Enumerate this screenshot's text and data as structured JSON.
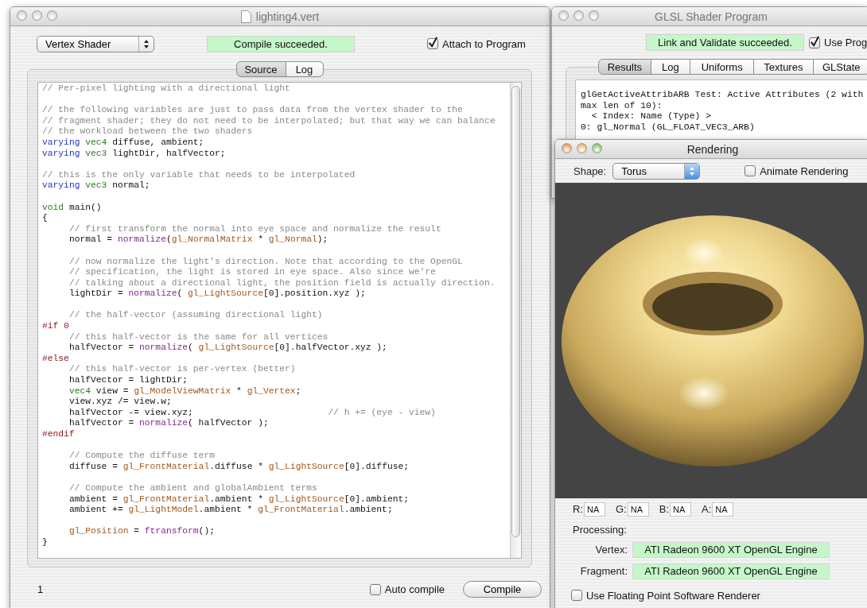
{
  "editor": {
    "title": "lighting4.vert",
    "shader_type": "Vertex Shader",
    "status": "Compile succeeded.",
    "attach": {
      "label": "Attach to Program",
      "checked": true
    },
    "tabs": [
      {
        "label": "Source",
        "selected": true
      },
      {
        "label": "Log",
        "selected": false
      }
    ],
    "code": [
      {
        "kind": "code",
        "tokens": [
          {
            "kind": "comment",
            "text": "// Per-pixel lighting with a directional light"
          }
        ]
      },
      {
        "kind": "blank"
      },
      {
        "kind": "code",
        "tokens": [
          {
            "kind": "comment",
            "text": "// the following variables are just to pass data from the vertex shader to the"
          }
        ]
      },
      {
        "kind": "code",
        "tokens": [
          {
            "kind": "comment",
            "text": "// fragment shader; they do not need to be interpolated; but that way we can balance"
          }
        ]
      },
      {
        "kind": "code",
        "tokens": [
          {
            "kind": "comment",
            "text": "// the workload between the two shaders"
          }
        ]
      },
      {
        "kind": "code",
        "tokens": [
          {
            "kind": "keyword",
            "text": "varying"
          },
          {
            "kind": "type",
            "text": " vec4"
          },
          {
            "kind": "plain",
            "text": " diffuse, ambient;"
          }
        ]
      },
      {
        "kind": "code",
        "tokens": [
          {
            "kind": "keyword",
            "text": "varying"
          },
          {
            "kind": "type",
            "text": " vec3"
          },
          {
            "kind": "plain",
            "text": " lightDir, halfVector;"
          }
        ]
      },
      {
        "kind": "blank"
      },
      {
        "kind": "code",
        "tokens": [
          {
            "kind": "comment",
            "text": "// this is the only variable that needs to be interpolated"
          }
        ]
      },
      {
        "kind": "code",
        "tokens": [
          {
            "kind": "keyword",
            "text": "varying"
          },
          {
            "kind": "type",
            "text": " vec3"
          },
          {
            "kind": "plain",
            "text": " normal;"
          }
        ]
      },
      {
        "kind": "blank"
      },
      {
        "kind": "code",
        "tokens": [
          {
            "kind": "type",
            "text": "void"
          },
          {
            "kind": "plain",
            "text": " main()"
          }
        ]
      },
      {
        "kind": "code",
        "tokens": [
          {
            "kind": "plain",
            "text": "{"
          }
        ]
      },
      {
        "kind": "code",
        "tokens": [
          {
            "kind": "comment",
            "text": "     // first transform the normal into eye space and normalize the result"
          }
        ]
      },
      {
        "kind": "code",
        "tokens": [
          {
            "kind": "plain",
            "text": "     normal = "
          },
          {
            "kind": "function",
            "text": "normalize"
          },
          {
            "kind": "plain",
            "text": "("
          },
          {
            "kind": "builtin",
            "text": "gl_NormalMatrix"
          },
          {
            "kind": "plain",
            "text": " * "
          },
          {
            "kind": "builtin",
            "text": "gl_Normal"
          },
          {
            "kind": "plain",
            "text": ");"
          }
        ]
      },
      {
        "kind": "blank"
      },
      {
        "kind": "code",
        "tokens": [
          {
            "kind": "comment",
            "text": "     // now normalize the light's direction. Note that according to the OpenGL"
          }
        ]
      },
      {
        "kind": "code",
        "tokens": [
          {
            "kind": "comment",
            "text": "     // specification, the light is stored in eye space. Also since we're"
          }
        ]
      },
      {
        "kind": "code",
        "tokens": [
          {
            "kind": "comment",
            "text": "     // talking about a directional light, the position field is actually direction."
          }
        ]
      },
      {
        "kind": "code",
        "tokens": [
          {
            "kind": "plain",
            "text": "     lightDir = "
          },
          {
            "kind": "function",
            "text": "normalize"
          },
          {
            "kind": "plain",
            "text": "( "
          },
          {
            "kind": "builtin",
            "text": "gl_LightSource"
          },
          {
            "kind": "plain",
            "text": "[0].position.xyz );"
          }
        ]
      },
      {
        "kind": "blank"
      },
      {
        "kind": "code",
        "tokens": [
          {
            "kind": "comment",
            "text": "     // the half-vector (assuming directional light)"
          }
        ]
      },
      {
        "kind": "code",
        "tokens": [
          {
            "kind": "preprocessor",
            "text": "#if 0"
          }
        ]
      },
      {
        "kind": "code",
        "tokens": [
          {
            "kind": "comment",
            "text": "     // this half-vector is the same for all vertices"
          }
        ]
      },
      {
        "kind": "code",
        "tokens": [
          {
            "kind": "plain",
            "text": "     halfVector = "
          },
          {
            "kind": "function",
            "text": "normalize"
          },
          {
            "kind": "plain",
            "text": "( "
          },
          {
            "kind": "builtin",
            "text": "gl_LightSource"
          },
          {
            "kind": "plain",
            "text": "[0].halfVector.xyz );"
          }
        ]
      },
      {
        "kind": "code",
        "tokens": [
          {
            "kind": "preprocessor",
            "text": "#else"
          }
        ]
      },
      {
        "kind": "code",
        "tokens": [
          {
            "kind": "comment",
            "text": "     // this half-vector is per-vertex (better)"
          }
        ]
      },
      {
        "kind": "code",
        "tokens": [
          {
            "kind": "plain",
            "text": "     halfVector = lightDir;"
          }
        ]
      },
      {
        "kind": "code",
        "tokens": [
          {
            "kind": "type",
            "text": "     vec4"
          },
          {
            "kind": "plain",
            "text": " view = "
          },
          {
            "kind": "builtin",
            "text": "gl_ModelViewMatrix"
          },
          {
            "kind": "plain",
            "text": " * "
          },
          {
            "kind": "builtin",
            "text": "gl_Vertex"
          },
          {
            "kind": "plain",
            "text": ";"
          }
        ]
      },
      {
        "kind": "code",
        "tokens": [
          {
            "kind": "plain",
            "text": "     view.xyz /= view.w;"
          }
        ]
      },
      {
        "kind": "code",
        "tokens": [
          {
            "kind": "plain",
            "text": "     halfVector -= view.xyz;                         "
          },
          {
            "kind": "comment",
            "text": "// h += (eye - view)"
          }
        ]
      },
      {
        "kind": "code",
        "tokens": [
          {
            "kind": "plain",
            "text": "     halfVector = "
          },
          {
            "kind": "function",
            "text": "normalize"
          },
          {
            "kind": "plain",
            "text": "( halfVector );"
          }
        ]
      },
      {
        "kind": "code",
        "tokens": [
          {
            "kind": "preprocessor",
            "text": "#endif"
          }
        ]
      },
      {
        "kind": "blank"
      },
      {
        "kind": "code",
        "tokens": [
          {
            "kind": "comment",
            "text": "     // Compute the diffuse term"
          }
        ]
      },
      {
        "kind": "code",
        "tokens": [
          {
            "kind": "plain",
            "text": "     diffuse = "
          },
          {
            "kind": "builtin",
            "text": "gl_FrontMaterial"
          },
          {
            "kind": "plain",
            "text": ".diffuse * "
          },
          {
            "kind": "builtin",
            "text": "gl_LightSource"
          },
          {
            "kind": "plain",
            "text": "[0].diffuse;"
          }
        ]
      },
      {
        "kind": "blank"
      },
      {
        "kind": "code",
        "tokens": [
          {
            "kind": "comment",
            "text": "     // Compute the ambient and globalAmbient terms"
          }
        ]
      },
      {
        "kind": "code",
        "tokens": [
          {
            "kind": "plain",
            "text": "     ambient = "
          },
          {
            "kind": "builtin",
            "text": "gl_FrontMaterial"
          },
          {
            "kind": "plain",
            "text": ".ambient * "
          },
          {
            "kind": "builtin",
            "text": "gl_LightSource"
          },
          {
            "kind": "plain",
            "text": "[0].ambient;"
          }
        ]
      },
      {
        "kind": "code",
        "tokens": [
          {
            "kind": "plain",
            "text": "     ambient += "
          },
          {
            "kind": "builtin",
            "text": "gl_LightModel"
          },
          {
            "kind": "plain",
            "text": ".ambient * "
          },
          {
            "kind": "builtin",
            "text": "gl_FrontMaterial"
          },
          {
            "kind": "plain",
            "text": ".ambient;"
          }
        ]
      },
      {
        "kind": "blank"
      },
      {
        "kind": "code",
        "tokens": [
          {
            "kind": "builtin",
            "text": "     gl_Position"
          },
          {
            "kind": "plain",
            "text": " = "
          },
          {
            "kind": "function",
            "text": "ftransform"
          },
          {
            "kind": "plain",
            "text": "();"
          }
        ]
      },
      {
        "kind": "code",
        "tokens": [
          {
            "kind": "plain",
            "text": "}"
          }
        ]
      }
    ],
    "line_number": "1",
    "auto_compile": {
      "label": "Auto compile",
      "checked": false
    },
    "compile_button": "Compile"
  },
  "program": {
    "title": "GLSL Shader Program",
    "status": "Link and Validate succeeded.",
    "use_program": {
      "label": "Use Prog",
      "checked": true
    },
    "tabs": [
      {
        "label": "Results",
        "selected": true
      },
      {
        "label": "Log",
        "selected": false
      },
      {
        "label": "Uniforms",
        "selected": false
      },
      {
        "label": "Textures",
        "selected": false
      },
      {
        "label": "GLState",
        "selected": false
      }
    ],
    "results": [
      "glGetActiveAttribARB Test: Active Attributes (2 with",
      "max len of 10):",
      "  < Index: Name (Type) >",
      "0: gl_Normal (GL_FLOAT_VEC3_ARB)"
    ]
  },
  "rendering": {
    "title": "Rendering",
    "shape_label": "Shape:",
    "shape": "Torus",
    "animate": {
      "label": "Animate Rendering",
      "checked": false
    },
    "channels": [
      {
        "label": "R:",
        "value": "NA"
      },
      {
        "label": "G:",
        "value": "NA"
      },
      {
        "label": "B:",
        "value": "NA"
      },
      {
        "label": "A:",
        "value": "NA"
      }
    ],
    "processing_label": "Processing:",
    "processors": [
      {
        "label": "Vertex:",
        "value": "ATI Radeon 9600 XT OpenGL Engine"
      },
      {
        "label": "Fragment:",
        "value": "ATI Radeon 9600 XT OpenGL Engine"
      }
    ],
    "software_renderer": {
      "label": "Use Floating Point Software Renderer",
      "checked": false
    }
  }
}
